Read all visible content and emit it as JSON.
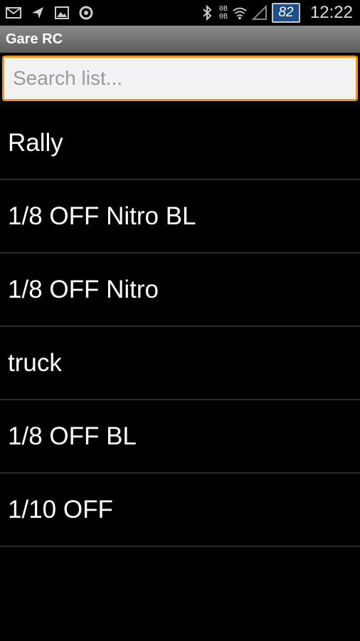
{
  "statusbar": {
    "icons_left": [
      "mail-icon",
      "send-icon",
      "image-icon",
      "refresh-icon"
    ],
    "data_top": "0B",
    "data_bottom": "0B",
    "battery_level": "82",
    "time": "12:22"
  },
  "app": {
    "title": "Gare RC"
  },
  "search": {
    "placeholder": "Search list..."
  },
  "list": {
    "items": [
      {
        "label": "Rally"
      },
      {
        "label": "1/8 OFF Nitro BL"
      },
      {
        "label": "1/8 OFF Nitro"
      },
      {
        "label": "truck"
      },
      {
        "label": "1/8 OFF BL"
      },
      {
        "label": "1/10 OFF"
      }
    ]
  }
}
